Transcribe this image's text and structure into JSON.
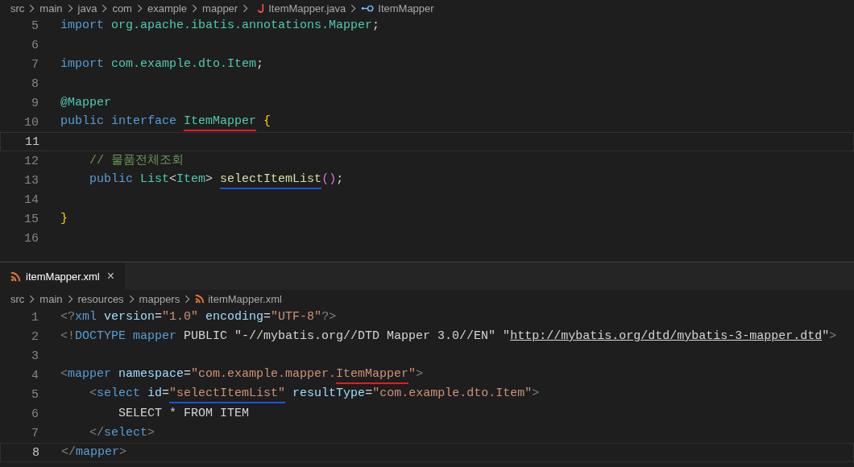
{
  "top_editor": {
    "breadcrumb": [
      {
        "label": "src",
        "kind": "folder"
      },
      {
        "label": "main",
        "kind": "folder"
      },
      {
        "label": "java",
        "kind": "folder"
      },
      {
        "label": "com",
        "kind": "folder"
      },
      {
        "label": "example",
        "kind": "folder"
      },
      {
        "label": "mapper",
        "kind": "folder"
      },
      {
        "label": "ItemMapper.java",
        "kind": "java"
      },
      {
        "label": "ItemMapper",
        "kind": "interface"
      }
    ],
    "lines": [
      {
        "number": "5",
        "current": false,
        "tokens": [
          {
            "text": "import",
            "kind": "keyword"
          },
          {
            "text": " org.apache.ibatis.annotations.Mapper",
            "kind": "type"
          },
          {
            "text": ";",
            "kind": "plain"
          }
        ]
      },
      {
        "number": "6",
        "current": false
      },
      {
        "number": "7",
        "current": false,
        "tokens": [
          {
            "text": "import",
            "kind": "keyword"
          },
          {
            "text": " com.example.dto.Item",
            "kind": "type"
          },
          {
            "text": ";",
            "kind": "plain"
          }
        ]
      },
      {
        "number": "8",
        "current": false
      },
      {
        "number": "9",
        "current": false,
        "tokens": [
          {
            "text": "@Mapper",
            "kind": "type"
          }
        ]
      },
      {
        "number": "10",
        "current": false,
        "tokens": [
          {
            "text": "public interface ",
            "kind": "keyword"
          },
          {
            "text": "ItemMapper",
            "kind": "type",
            "underline": {
              "color": "#e51c23"
            }
          },
          {
            "text": " {",
            "kind": "brace"
          }
        ]
      },
      {
        "number": "11",
        "current": true
      },
      {
        "number": "12",
        "current": false,
        "tokens": [
          {
            "text": "    // 물품전체조회",
            "kind": "comment"
          }
        ]
      },
      {
        "number": "13",
        "current": false,
        "tokens": [
          {
            "text": "    public ",
            "kind": "keyword"
          },
          {
            "text": "List",
            "kind": "type"
          },
          {
            "text": "<",
            "kind": "plain"
          },
          {
            "text": "Item",
            "kind": "type"
          },
          {
            "text": "> ",
            "kind": "plain"
          },
          {
            "text": "selectItemList",
            "kind": "function",
            "underline": {
              "color": "#1a56db"
            }
          },
          {
            "text": "()",
            "kind": "paren"
          },
          {
            "text": ";",
            "kind": "plain"
          }
        ]
      },
      {
        "number": "14",
        "current": false
      },
      {
        "number": "15",
        "current": false,
        "tokens": [
          {
            "text": "}",
            "kind": "brace"
          }
        ]
      },
      {
        "number": "16",
        "current": false
      }
    ]
  },
  "bottom_editor": {
    "tabs": [
      {
        "label": "itemMapper.xml",
        "kind": "xml",
        "selected": true,
        "close": "×"
      }
    ],
    "breadcrumb": [
      {
        "label": "src",
        "kind": "folder"
      },
      {
        "label": "main",
        "kind": "folder"
      },
      {
        "label": "resources",
        "kind": "folder"
      },
      {
        "label": "mappers",
        "kind": "folder"
      },
      {
        "label": "itemMapper.xml",
        "kind": "xml"
      }
    ],
    "lines": [
      {
        "number": "1",
        "current": false,
        "tokens": [
          {
            "text": "<?",
            "kind": "bracket"
          },
          {
            "text": "xml",
            "kind": "tag"
          },
          {
            "text": " version",
            "kind": "attr"
          },
          {
            "text": "=",
            "kind": "plain"
          },
          {
            "text": "\"1.0\"",
            "kind": "string"
          },
          {
            "text": " encoding",
            "kind": "attr"
          },
          {
            "text": "=",
            "kind": "plain"
          },
          {
            "text": "\"UTF-8\"",
            "kind": "string"
          },
          {
            "text": "?>",
            "kind": "bracket"
          }
        ]
      },
      {
        "number": "2",
        "current": false,
        "tokens": [
          {
            "text": "<!",
            "kind": "bracket"
          },
          {
            "text": "DOCTYPE",
            "kind": "tag"
          },
          {
            "text": " mapper",
            "kind": "tag"
          },
          {
            "text": " PUBLIC ",
            "kind": "plain"
          },
          {
            "text": "\"-//mybatis.org//DTD Mapper 3.0//EN\" \"",
            "kind": "plain"
          },
          {
            "text": "http://mybatis.org/dtd/mybatis-3-mapper.dtd",
            "kind": "link"
          },
          {
            "text": "\"",
            "kind": "plain"
          },
          {
            "text": ">",
            "kind": "bracket"
          }
        ]
      },
      {
        "number": "3",
        "current": false
      },
      {
        "number": "4",
        "current": false,
        "tokens": [
          {
            "text": "<",
            "kind": "bracket"
          },
          {
            "text": "mapper",
            "kind": "tag"
          },
          {
            "text": " namespace",
            "kind": "attr"
          },
          {
            "text": "=",
            "kind": "plain"
          },
          {
            "text": "\"com.example.mapper.",
            "kind": "string"
          },
          {
            "text": "ItemMapper",
            "kind": "string",
            "underline": {
              "color": "#e51c23"
            }
          },
          {
            "text": "\"",
            "kind": "string"
          },
          {
            "text": ">",
            "kind": "bracket"
          }
        ]
      },
      {
        "number": "5",
        "current": false,
        "tokens": [
          {
            "text": "    <",
            "kind": "bracket"
          },
          {
            "text": "select",
            "kind": "tag"
          },
          {
            "text": " id",
            "kind": "attr"
          },
          {
            "text": "=",
            "kind": "plain"
          },
          {
            "text": "\"selectItemList\"",
            "kind": "string",
            "underline": {
              "color": "#1a56db"
            }
          },
          {
            "text": " resultType",
            "kind": "attr"
          },
          {
            "text": "=",
            "kind": "plain"
          },
          {
            "text": "\"com.example.dto.Item\"",
            "kind": "string"
          },
          {
            "text": ">",
            "kind": "bracket"
          }
        ]
      },
      {
        "number": "6",
        "current": false,
        "tokens": [
          {
            "text": "        SELECT * FROM ITEM",
            "kind": "plain"
          }
        ]
      },
      {
        "number": "7",
        "current": false,
        "tokens": [
          {
            "text": "    </",
            "kind": "bracket"
          },
          {
            "text": "select",
            "kind": "tag"
          },
          {
            "text": ">",
            "kind": "bracket"
          }
        ]
      },
      {
        "number": "8",
        "current": true,
        "tokens": [
          {
            "text": "</",
            "kind": "bracket"
          },
          {
            "text": "mapper",
            "kind": "tag"
          },
          {
            "text": ">",
            "kind": "bracket"
          }
        ]
      }
    ]
  }
}
